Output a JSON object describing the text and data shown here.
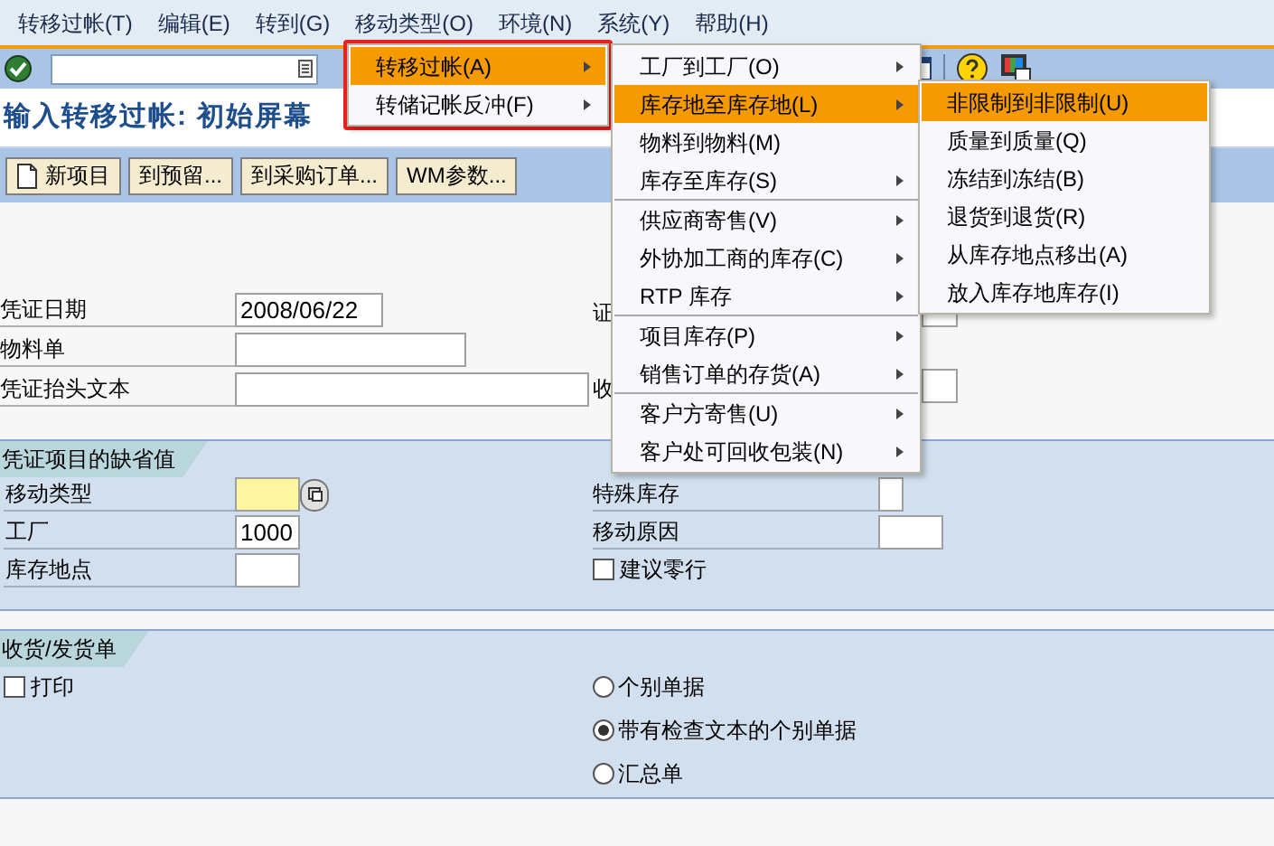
{
  "menu_bar": [
    {
      "label": "转移过帐(T)"
    },
    {
      "label": "编辑(E)"
    },
    {
      "label": "转到(G)"
    },
    {
      "label": "移动类型(O)"
    },
    {
      "label": "环境(N)"
    },
    {
      "label": "系统(Y)"
    },
    {
      "label": "帮助(H)"
    }
  ],
  "title": "输入转移过帐: 初始屏幕",
  "app_toolbar": [
    {
      "label": "新项目",
      "kind": "document"
    },
    {
      "label": "到预留...",
      "kind": "plain"
    },
    {
      "label": "到采购订单...",
      "kind": "plain"
    },
    {
      "label": "WM参数...",
      "kind": "plain"
    }
  ],
  "header_fields": [
    {
      "label": "凭证日期",
      "value": "2008/06/22"
    },
    {
      "label": "物料单"
    },
    {
      "label": "凭证抬头文本"
    }
  ],
  "header_right_fields": [
    {
      "label": "证"
    },
    {
      "label": "收"
    }
  ],
  "defaults_group": {
    "title": "凭证项目的缺省值",
    "left_fields": [
      {
        "label": "移动类型",
        "required": true
      },
      {
        "label": "工厂",
        "value": "1000",
        "required": false
      },
      {
        "label": "库存地点",
        "required": false
      }
    ],
    "right_fields": [
      {
        "label": "特殊库存"
      },
      {
        "label": "移动原因"
      }
    ],
    "checkbox": {
      "label": "建议零行",
      "checked": false
    }
  },
  "print_group": {
    "title": "收货/发货单",
    "checkbox": {
      "label": "打印",
      "checked": false
    },
    "radios": [
      {
        "label": "个别单据",
        "selected": false
      },
      {
        "label": "带有检查文本的个别单据",
        "selected": true
      },
      {
        "label": "汇总单",
        "selected": false
      }
    ]
  },
  "menus": [
    {
      "items": [
        {
          "label": "转移过帐(A)",
          "selected": true,
          "submenu": true,
          "separator_after": false
        },
        {
          "label": "转储记帐反冲(F)",
          "selected": false,
          "submenu": true,
          "separator_after": false
        }
      ]
    },
    {
      "items": [
        {
          "label": "工厂到工厂(O)",
          "selected": false,
          "submenu": true,
          "separator_after": false
        },
        {
          "label": "库存地至库存地(L)",
          "selected": true,
          "submenu": true,
          "separator_after": false
        },
        {
          "label": "物料到物料(M)",
          "selected": false,
          "submenu": false,
          "separator_after": false
        },
        {
          "label": "库存至库存(S)",
          "selected": false,
          "submenu": true,
          "separator_after": true
        },
        {
          "label": "供应商寄售(V)",
          "selected": false,
          "submenu": true,
          "separator_after": false
        },
        {
          "label": "外协加工商的库存(C)",
          "selected": false,
          "submenu": true,
          "separator_after": false
        },
        {
          "label": "RTP 库存",
          "selected": false,
          "submenu": true,
          "separator_after": true
        },
        {
          "label": "项目库存(P)",
          "selected": false,
          "submenu": true,
          "separator_after": false
        },
        {
          "label": "销售订单的存货(A)",
          "selected": false,
          "submenu": true,
          "separator_after": true
        },
        {
          "label": "客户方寄售(U)",
          "selected": false,
          "submenu": true,
          "separator_after": false
        },
        {
          "label": "客户处可回收包装(N)",
          "selected": false,
          "submenu": true,
          "separator_after": false
        }
      ]
    },
    {
      "items": [
        {
          "label": "非限制到非限制(U)",
          "selected": true,
          "submenu": false,
          "separator_after": false
        },
        {
          "label": "质量到质量(Q)",
          "selected": false,
          "submenu": false,
          "separator_after": false
        },
        {
          "label": "冻结到冻结(B)",
          "selected": false,
          "submenu": false,
          "separator_after": false
        },
        {
          "label": "退货到退货(R)",
          "selected": false,
          "submenu": false,
          "separator_after": false
        },
        {
          "label": "从库存地点移出(A)",
          "selected": false,
          "submenu": false,
          "separator_after": false
        },
        {
          "label": "放入库存地库存(I)",
          "selected": false,
          "submenu": false,
          "separator_after": false
        }
      ]
    }
  ]
}
